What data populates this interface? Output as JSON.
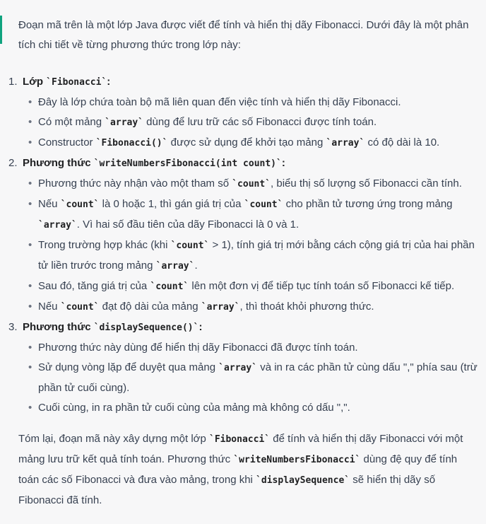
{
  "intro": "Đoạn mã trên là một lớp Java được viết để tính và hiển thị dãy Fibonacci. Dưới đây là một phân tích chi tiết về từng phương thức trong lớp này:",
  "sections": [
    {
      "num": "1.",
      "label": "Lớp ",
      "code": "`Fibonacci`",
      "colon": ":",
      "bullets": [
        [
          "Đây là lớp chứa toàn bộ mã liên quan đến việc tính và hiển thị dãy Fibonacci."
        ],
        [
          "Có một mảng ",
          "`array`",
          " dùng để lưu trữ các số Fibonacci được tính toán."
        ],
        [
          "Constructor ",
          "`Fibonacci()`",
          " được sử dụng để khởi tạo mảng ",
          "`array`",
          " có độ dài là 10."
        ]
      ]
    },
    {
      "num": "2.",
      "label": "Phương thức ",
      "code": "`writeNumbersFibonacci(int count)`",
      "colon": ":",
      "bullets": [
        [
          "Phương thức này nhận vào một tham số ",
          "`count`",
          ", biểu thị số lượng số Fibonacci cần tính."
        ],
        [
          "Nếu ",
          "`count`",
          " là 0 hoặc 1, thì gán giá trị của ",
          "`count`",
          " cho phần tử tương ứng trong mảng ",
          "`array`",
          ". Vì hai số đầu tiên của dãy Fibonacci là 0 và 1."
        ],
        [
          "Trong trường hợp khác (khi ",
          "`count`",
          " > 1), tính giá trị mới bằng cách cộng giá trị của hai phần tử liền trước trong mảng ",
          "`array`",
          "."
        ],
        [
          "Sau đó, tăng giá trị của ",
          "`count`",
          " lên một đơn vị để tiếp tục tính toán số Fibonacci kế tiếp."
        ],
        [
          "Nếu ",
          "`count`",
          " đạt độ dài của mảng ",
          "`array`",
          ", thì thoát khỏi phương thức."
        ]
      ]
    },
    {
      "num": "3.",
      "label": "Phương thức ",
      "code": "`displaySequence()`",
      "colon": ":",
      "bullets": [
        [
          "Phương thức này dùng để hiển thị dãy Fibonacci đã được tính toán."
        ],
        [
          "Sử dụng vòng lặp để duyệt qua mảng ",
          "`array`",
          " và in ra các phần tử cùng dấu \",\" phía sau (trừ phần tử cuối cùng)."
        ],
        [
          "Cuối cùng, in ra phần tử cuối cùng của mảng mà không có dấu \",\"."
        ]
      ]
    }
  ],
  "summary": [
    "Tóm lại, đoạn mã này xây dựng một lớp ",
    "`Fibonacci`",
    " để tính và hiển thị dãy Fibonacci với một mảng lưu trữ kết quả tính toán. Phương thức ",
    "`writeNumbersFibonacci`",
    " dùng đệ quy để tính toán các số Fibonacci và đưa vào mảng, trong khi ",
    "`displaySequence`",
    " sẽ hiển thị dãy số Fibonacci đã tính."
  ],
  "accent_color": "#10a37f"
}
